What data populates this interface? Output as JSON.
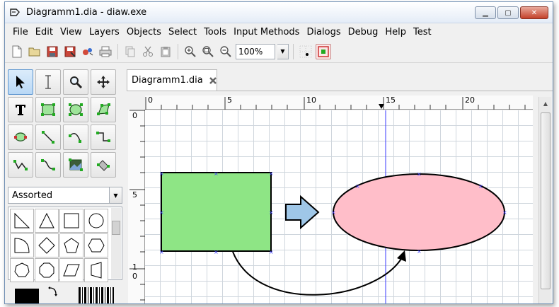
{
  "window": {
    "title": "Diagramm1.dia - diaw.exe",
    "controls": {
      "minimize": "▁",
      "maximize": "▢",
      "close": "✕"
    }
  },
  "menubar": {
    "items": [
      "File",
      "Edit",
      "View",
      "Layers",
      "Objects",
      "Select",
      "Tools",
      "Input Methods",
      "Dialogs",
      "Debug",
      "Help",
      "Test"
    ]
  },
  "toolbar": {
    "zoom_value": "100%"
  },
  "toolbox": {
    "sheet_selected": "Assorted"
  },
  "document": {
    "tab_label": "Diagramm1.dia",
    "ruler_top_labels": [
      "0",
      "5",
      "10",
      "15",
      "20"
    ],
    "ruler_left_labels": [
      "0",
      "5",
      "1",
      "0"
    ]
  },
  "colors": {
    "rectangle_fill": "#8ee585",
    "ellipse_fill": "#ffbec9",
    "arrow_fill": "#9fc7e8",
    "guide_line": "#3a3aff",
    "grid": "#cfd6dd"
  }
}
